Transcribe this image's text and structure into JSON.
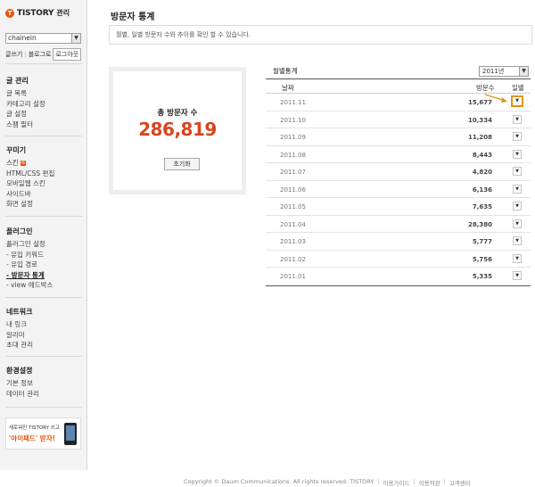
{
  "brand": {
    "logo_mark": "T",
    "name": "TISTORY",
    "suffix": "관리"
  },
  "blog_select": {
    "value": "chainein"
  },
  "quick_links": {
    "write": "글쓰기",
    "sep": "|",
    "blog": "블로그로",
    "logout": "로그아웃"
  },
  "sidebar": {
    "groups": [
      {
        "title": "글 관리",
        "items": [
          "글 목록",
          "카테고리 설정",
          "글 설정",
          "스팸 필터"
        ]
      },
      {
        "title": "꾸미기",
        "items": [
          "스킨",
          "HTML/CSS 편집",
          "모바일웹 스킨",
          "사이드바",
          "화면 설정"
        ]
      },
      {
        "title": "플러그인",
        "items": [
          "플러그인 설정",
          "- 유입 키워드",
          "- 유입 경로",
          "- 방문자 통계",
          "- view 에드박스"
        ]
      },
      {
        "title": "네트워크",
        "items": [
          "내 링크",
          "알리미",
          "초대 관리"
        ]
      },
      {
        "title": "환경설정",
        "items": [
          "기본 정보",
          "데이터 관리"
        ]
      }
    ],
    "skin_badge": "N"
  },
  "promo": {
    "line1": "새로워진 TISTORY 쓰고",
    "line2": "'아이패드' 받자!"
  },
  "page": {
    "title": "방문자 통계",
    "description": "월별, 일별 방문자 수와 추이를 확인 할 수 있습니다."
  },
  "total": {
    "label": "총 방문자 수",
    "value": "286,819",
    "reset_label": "초기화"
  },
  "monthly": {
    "label": "월별통계",
    "year": "2011년",
    "columns": {
      "date": "날짜",
      "count": "방문수",
      "daily": "일별"
    },
    "rows": [
      {
        "month": "2011.11",
        "count": "15,677"
      },
      {
        "month": "2011.10",
        "count": "10,334"
      },
      {
        "month": "2011.09",
        "count": "11,208"
      },
      {
        "month": "2011.08",
        "count": "8,443"
      },
      {
        "month": "2011.07",
        "count": "4,820"
      },
      {
        "month": "2011.06",
        "count": "6,136"
      },
      {
        "month": "2011.05",
        "count": "7,635"
      },
      {
        "month": "2011.04",
        "count": "28,380"
      },
      {
        "month": "2011.03",
        "count": "5,777"
      },
      {
        "month": "2011.02",
        "count": "5,756"
      },
      {
        "month": "2011.01",
        "count": "5,335"
      }
    ],
    "daily_button_glyph": "▼"
  },
  "footer": {
    "copyright": "Copyright © Daum Communications. All rights reserved. TISTORY",
    "sep": "|",
    "links": [
      "이용가이드",
      "이용약관",
      "고객센터"
    ]
  },
  "colors": {
    "accent": "#e8540e",
    "total_value": "#d8451e",
    "highlight": "#e39414"
  }
}
